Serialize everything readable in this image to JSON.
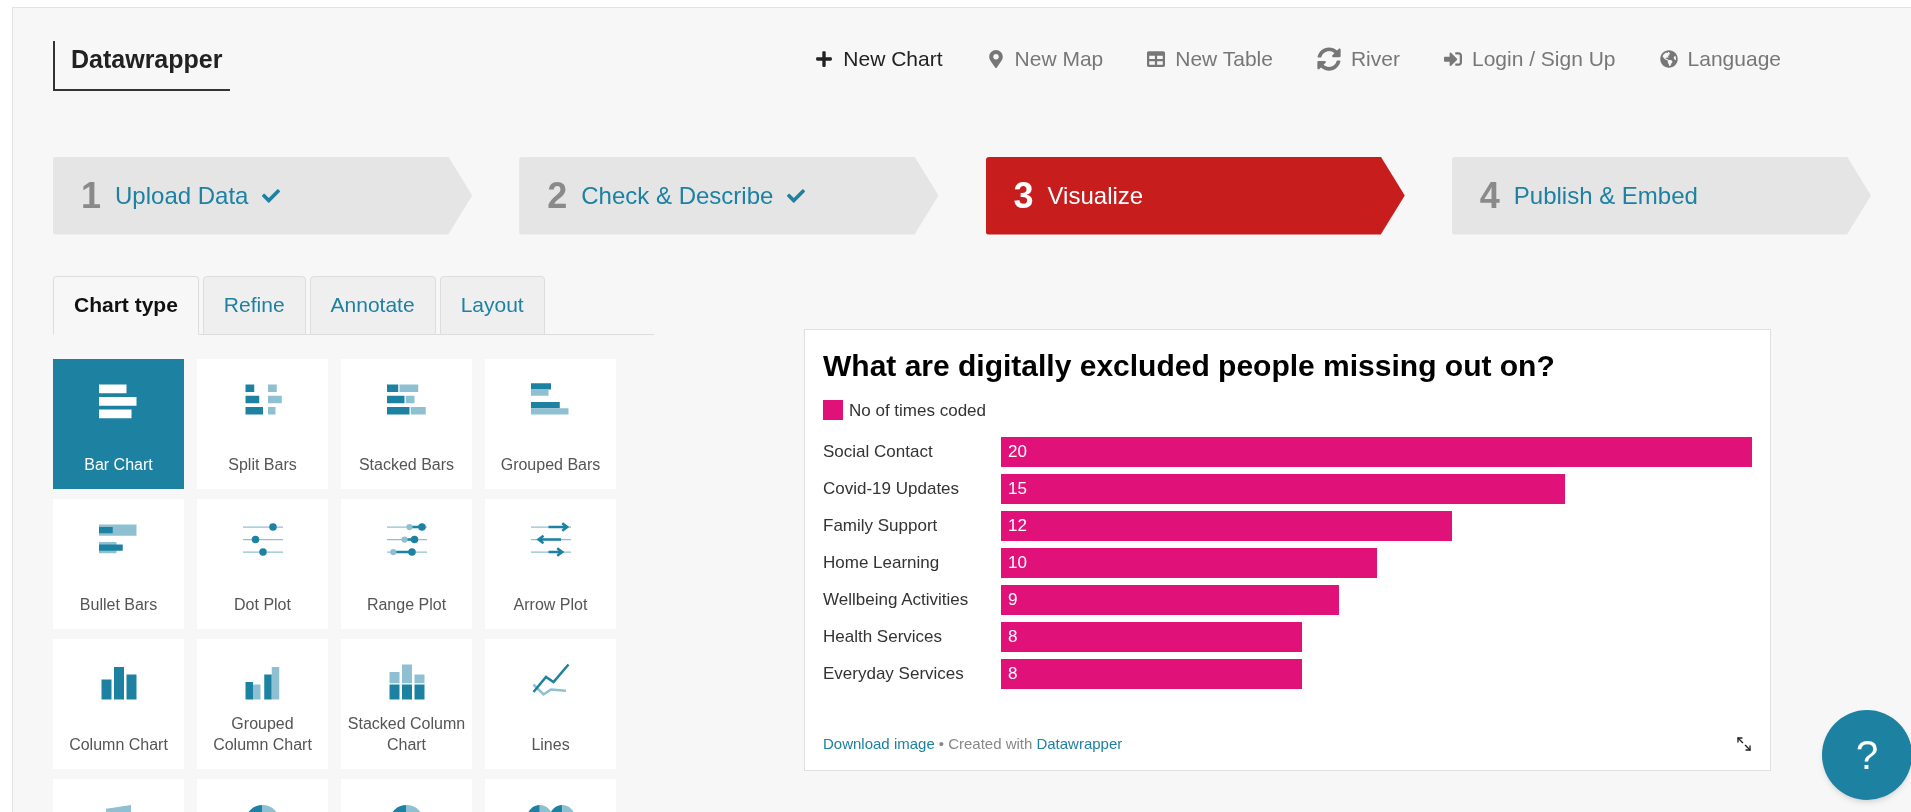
{
  "logo": "Datawrapper",
  "nav": [
    {
      "label": "New Chart",
      "highlighted": true
    },
    {
      "label": "New Map",
      "highlighted": false
    },
    {
      "label": "New Table",
      "highlighted": false
    },
    {
      "label": "River",
      "highlighted": false
    },
    {
      "label": "Login / Sign Up",
      "highlighted": false
    },
    {
      "label": "Language",
      "highlighted": false
    }
  ],
  "steps": [
    {
      "number": "1",
      "label": "Upload Data",
      "done": true,
      "selected": false
    },
    {
      "number": "2",
      "label": "Check & Describe",
      "done": true,
      "selected": false
    },
    {
      "number": "3",
      "label": "Visualize",
      "done": false,
      "selected": true
    },
    {
      "number": "4",
      "label": "Publish & Embed",
      "done": false,
      "selected": false
    }
  ],
  "tabs": [
    {
      "label": "Chart type",
      "selected": true
    },
    {
      "label": "Refine",
      "selected": false
    },
    {
      "label": "Annotate",
      "selected": false
    },
    {
      "label": "Layout",
      "selected": false
    }
  ],
  "chart_types": [
    {
      "label": "Bar Chart",
      "kind": "bar",
      "selected": true
    },
    {
      "label": "Split Bars",
      "kind": "split",
      "selected": false
    },
    {
      "label": "Stacked Bars",
      "kind": "stacked",
      "selected": false
    },
    {
      "label": "Grouped Bars",
      "kind": "grouped",
      "selected": false
    },
    {
      "label": "Bullet Bars",
      "kind": "bullet",
      "selected": false
    },
    {
      "label": "Dot Plot",
      "kind": "dot",
      "selected": false
    },
    {
      "label": "Range Plot",
      "kind": "range",
      "selected": false
    },
    {
      "label": "Arrow Plot",
      "kind": "arrow",
      "selected": false
    },
    {
      "label": "Column Chart",
      "kind": "column",
      "selected": false
    },
    {
      "label": "Grouped Column Chart",
      "kind": "groupedcolumn",
      "selected": false
    },
    {
      "label": "Stacked Column Chart",
      "kind": "stackedcolumn",
      "selected": false
    },
    {
      "label": "Lines",
      "kind": "lines",
      "selected": false
    },
    {
      "kind": "area",
      "selected": false
    },
    {
      "kind": "pie",
      "selected": false
    },
    {
      "kind": "donut",
      "selected": false
    },
    {
      "kind": "multipie",
      "selected": false
    }
  ],
  "chart": {
    "chart_data": {
      "type": "bar",
      "orientation": "horizontal",
      "title": "What are digitally excluded people missing out on?",
      "categories": [
        "Social Contact",
        "Covid-19 Updates",
        "Family Support",
        "Home Learning",
        "Wellbeing Activities",
        "Health Services",
        "Everyday Services"
      ],
      "series": [
        {
          "name": "No of times coded",
          "color": "#e0127a",
          "values": [
            20,
            15,
            12,
            10,
            9,
            8,
            8
          ]
        }
      ],
      "data_labels": true
    },
    "footer": {
      "link1": "Download image",
      "text": "• Created with",
      "link2": "Datawrapper"
    }
  },
  "help": "?"
}
